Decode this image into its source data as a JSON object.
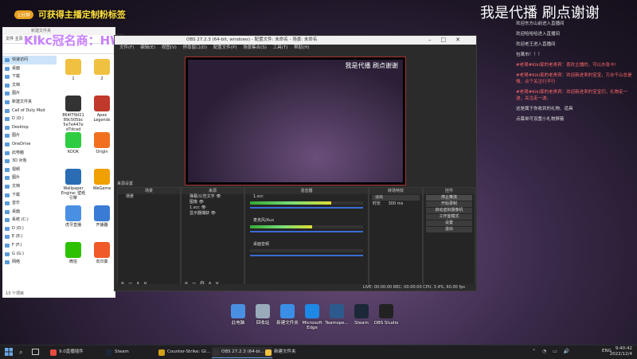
{
  "overlay": {
    "badge": "1分钟",
    "banner_text": "可获得主播定制粉标签",
    "logo": "Kikc冠名商：HW"
  },
  "stream": {
    "title": "我是代播 刷点谢谢"
  },
  "chat": [
    {
      "text": "欢迎东方山前进入直播间",
      "hl": false
    },
    {
      "text": "欢迎哈哈哈进入直播间",
      "hl": false
    },
    {
      "text": "欢迎老王进入直播间",
      "hl": false
    },
    {
      "text": "包萬市！！！",
      "hl": false
    },
    {
      "text": "#老哥#Kiki家的老贵宾：喜欢主播的，可以办张卡!",
      "hl": true
    },
    {
      "text": "#老哥#Kiki家的老贵宾：欢迎新进来的宝宝，万水千山总是情，点个关注行不行",
      "hl": true
    },
    {
      "text": "#老哥#Kiki家的老贵宾：欢迎新进来的宝宝们，礼物走一波，关注走一波。",
      "hl": true
    },
    {
      "text": "这是属于你收到的礼物、道具",
      "hl": false
    },
    {
      "text": "点幕单可设置小礼物屏蔽",
      "hl": false
    }
  ],
  "explorer": {
    "title": "新建文件夹",
    "ribbon": "文件   主页   共享   查看",
    "nav": [
      {
        "label": "快速访问",
        "sel": true
      },
      {
        "label": "桌面"
      },
      {
        "label": "下载"
      },
      {
        "label": "文档"
      },
      {
        "label": "图片"
      },
      {
        "label": "新建文件夹"
      },
      {
        "label": "Call of Duty  Mod"
      },
      {
        "label": "D (D:)"
      },
      {
        "label": "Desktop"
      },
      {
        "label": "图片"
      },
      {
        "label": "OneDrive"
      },
      {
        "label": "此电脑"
      },
      {
        "label": "3D 对象"
      },
      {
        "label": "视频"
      },
      {
        "label": "图片"
      },
      {
        "label": "文档"
      },
      {
        "label": "下载"
      },
      {
        "label": "音乐"
      },
      {
        "label": "桌面"
      },
      {
        "label": "系统 (C:)"
      },
      {
        "label": "D (D:)"
      },
      {
        "label": "E (E:)"
      },
      {
        "label": "F (F:)"
      },
      {
        "label": "G (G:)"
      },
      {
        "label": "网络"
      }
    ],
    "files": [
      {
        "label": "1",
        "color": "#f0c040"
      },
      {
        "label": "2",
        "color": "#f0c040"
      },
      {
        "label": "864f7fbf21 89c505bc 5e7e447e d7dcad",
        "color": "#333333"
      },
      {
        "label": "Apex Legends",
        "color": "#c0392b"
      },
      {
        "label": "KOOK",
        "color": "#2ecc40"
      },
      {
        "label": "Origin",
        "color": "#f07020"
      },
      {
        "label": "Wallpaper Engine: 壁纸引擎",
        "color": "#2a6db5"
      },
      {
        "label": "WeGame",
        "color": "#f0a000"
      },
      {
        "label": "虎牙直播",
        "color": "#4a90e2"
      },
      {
        "label": "开播器",
        "color": "#3a7bd5"
      },
      {
        "label": "微信",
        "color": "#2dc100"
      },
      {
        "label": "向日葵",
        "color": "#f05a28"
      }
    ],
    "status": "13 个项目"
  },
  "obs": {
    "title": "OBS 27.2.3 (64-bit, windows) - 配置文件: 未命名 - 场景: 未命名",
    "menu": "文件(F) 编辑(E) 视图(V) 停靠窗口(D) 配置文件(P) 场景集合(S) 工具(T) 帮助(H)",
    "preview_title": "我是代播 刷点谢谢",
    "scenes_label": "来源设置",
    "scenes_header": "场景",
    "scenes": [
      "场景"
    ],
    "sources_header": "来源",
    "sources": [
      "弹幕/公告文字",
      "图像",
      "1.scc",
      "显示器捕获"
    ],
    "mixer_header": "混音器",
    "mixer": [
      {
        "name": "1.scc",
        "level": 0.72
      },
      {
        "name": "麦克风/Aux",
        "level": 0.55
      },
      {
        "name": "桌面音频",
        "level": 0.0
      }
    ],
    "transitions_header": "转场特效",
    "transition": "淡出",
    "duration_label": "时长",
    "duration": "300 ms",
    "controls_header": "控件",
    "controls": [
      "停止推流",
      "开始录制",
      "启动虚拟摄像机",
      "工作室模式",
      "设置",
      "退出"
    ],
    "status": "LIVE: 00:00:00   REC: 00:00:00   CPU: 3.4%, 60.00 fps"
  },
  "desktop_icons": [
    {
      "label": "此电脑",
      "color": "#4a90e2"
    },
    {
      "label": "回收站",
      "color": "#9ab"
    },
    {
      "label": "新建文件夹",
      "color": "#3a8ee6"
    },
    {
      "label": "Microsoft Edge",
      "color": "#1e88e5"
    },
    {
      "label": "Teamspe...",
      "color": "#2c5a8c"
    },
    {
      "label": "Steam",
      "color": "#1b2838"
    },
    {
      "label": "OBS Studio",
      "color": "#222222"
    }
  ],
  "taskbar": {
    "items": [
      {
        "label": "9.0直播插件",
        "color": "#e84c3d",
        "active": false
      },
      {
        "label": "Steam",
        "color": "#1b2838",
        "active": false
      },
      {
        "label": "Counter-Strike: Gl...",
        "color": "#d4a017",
        "active": false
      },
      {
        "label": "OBS 27.2.3 (64-bi...",
        "color": "#333333",
        "active": true
      },
      {
        "label": "新建文件夹",
        "color": "#f0c040",
        "active": false
      }
    ],
    "lang": "ENG",
    "time": "9:40:42",
    "date": "2022/12/4"
  }
}
